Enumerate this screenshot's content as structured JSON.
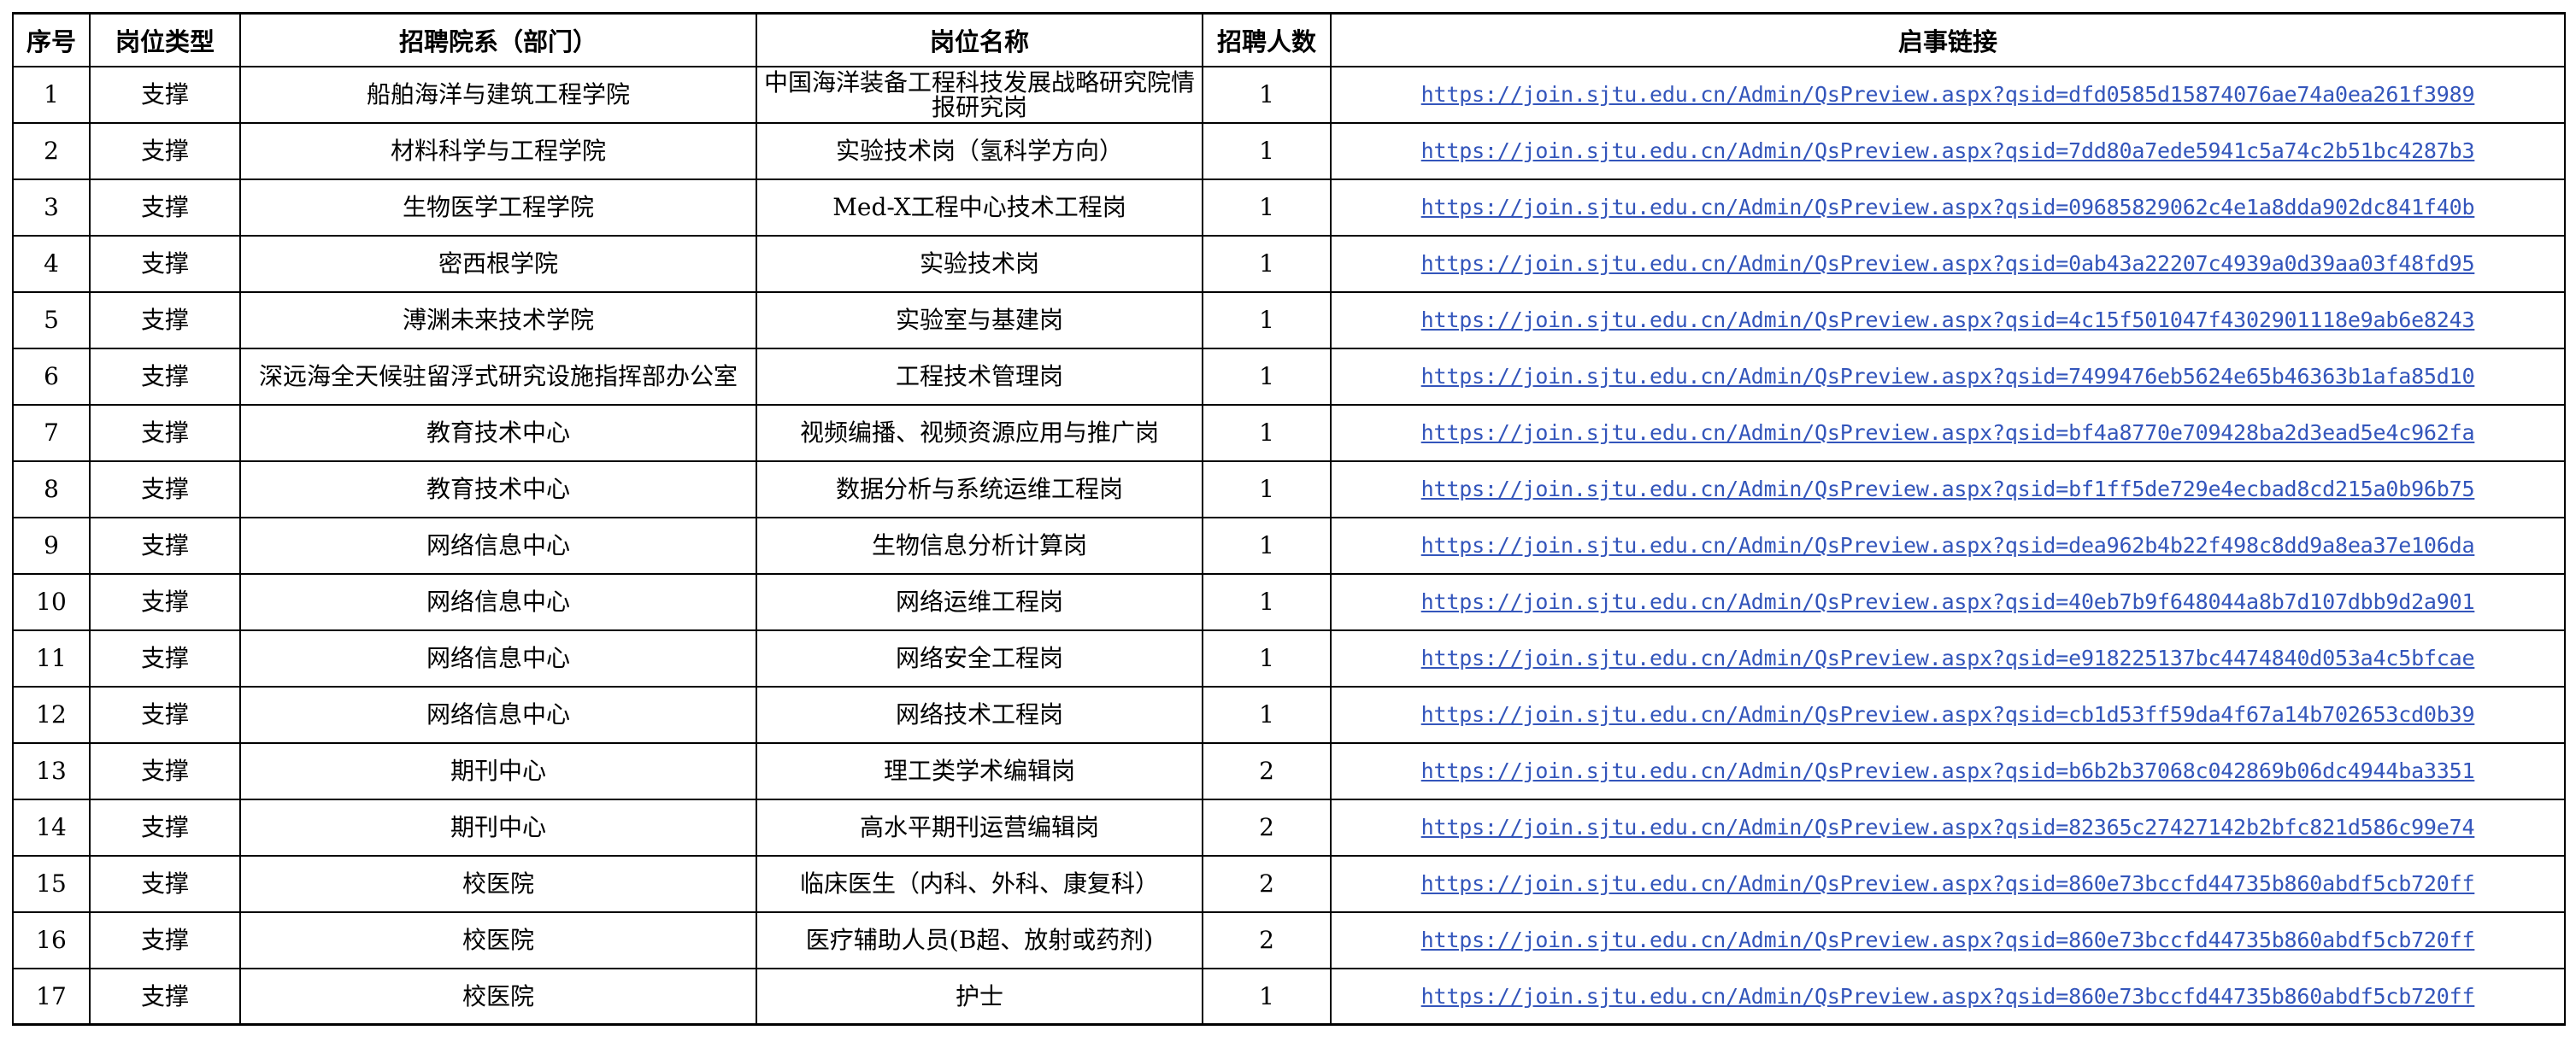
{
  "columns": [
    "序号",
    "岗位类型",
    "招聘院系（部门）",
    "岗位名称",
    "招聘人数",
    "启事链接"
  ],
  "rows": [
    {
      "no": "1",
      "type": "支撑",
      "dept": "船舶海洋与建筑工程学院",
      "position": "中国海洋装备工程科技发展战略研究院情报研究岗",
      "count": "1",
      "link": "https://join.sjtu.edu.cn/Admin/QsPreview.aspx?qsid=dfd0585d15874076ae74a0ea261f3989"
    },
    {
      "no": "2",
      "type": "支撑",
      "dept": "材料科学与工程学院",
      "position": "实验技术岗（氢科学方向）",
      "count": "1",
      "link": "https://join.sjtu.edu.cn/Admin/QsPreview.aspx?qsid=7dd80a7ede5941c5a74c2b51bc4287b3"
    },
    {
      "no": "3",
      "type": "支撑",
      "dept": "生物医学工程学院",
      "position": "Med-X工程中心技术工程岗",
      "count": "1",
      "link": "https://join.sjtu.edu.cn/Admin/QsPreview.aspx?qsid=09685829062c4e1a8dda902dc841f40b"
    },
    {
      "no": "4",
      "type": "支撑",
      "dept": "密西根学院",
      "position": "实验技术岗",
      "count": "1",
      "link": "https://join.sjtu.edu.cn/Admin/QsPreview.aspx?qsid=0ab43a22207c4939a0d39aa03f48fd95"
    },
    {
      "no": "5",
      "type": "支撑",
      "dept": "溥渊未来技术学院",
      "position": "实验室与基建岗",
      "count": "1",
      "link": "https://join.sjtu.edu.cn/Admin/QsPreview.aspx?qsid=4c15f501047f4302901118e9ab6e8243"
    },
    {
      "no": "6",
      "type": "支撑",
      "dept": "深远海全天候驻留浮式研究设施指挥部办公室",
      "position": "工程技术管理岗",
      "count": "1",
      "link": "https://join.sjtu.edu.cn/Admin/QsPreview.aspx?qsid=7499476eb5624e65b46363b1afa85d10"
    },
    {
      "no": "7",
      "type": "支撑",
      "dept": "教育技术中心",
      "position": "视频编播、视频资源应用与推广岗",
      "count": "1",
      "link": "https://join.sjtu.edu.cn/Admin/QsPreview.aspx?qsid=bf4a8770e709428ba2d3ead5e4c962fa"
    },
    {
      "no": "8",
      "type": "支撑",
      "dept": "教育技术中心",
      "position": "数据分析与系统运维工程岗",
      "count": "1",
      "link": "https://join.sjtu.edu.cn/Admin/QsPreview.aspx?qsid=bf1ff5de729e4ecbad8cd215a0b96b75"
    },
    {
      "no": "9",
      "type": "支撑",
      "dept": "网络信息中心",
      "position": "生物信息分析计算岗",
      "count": "1",
      "link": "https://join.sjtu.edu.cn/Admin/QsPreview.aspx?qsid=dea962b4b22f498c8dd9a8ea37e106da"
    },
    {
      "no": "10",
      "type": "支撑",
      "dept": "网络信息中心",
      "position": "网络运维工程岗",
      "count": "1",
      "link": "https://join.sjtu.edu.cn/Admin/QsPreview.aspx?qsid=40eb7b9f648044a8b7d107dbb9d2a901"
    },
    {
      "no": "11",
      "type": "支撑",
      "dept": "网络信息中心",
      "position": "网络安全工程岗",
      "count": "1",
      "link": "https://join.sjtu.edu.cn/Admin/QsPreview.aspx?qsid=e918225137bc4474840d053a4c5bfcae"
    },
    {
      "no": "12",
      "type": "支撑",
      "dept": "网络信息中心",
      "position": "网络技术工程岗",
      "count": "1",
      "link": "https://join.sjtu.edu.cn/Admin/QsPreview.aspx?qsid=cb1d53ff59da4f67a14b702653cd0b39"
    },
    {
      "no": "13",
      "type": "支撑",
      "dept": "期刊中心",
      "position": "理工类学术编辑岗",
      "count": "2",
      "link": "https://join.sjtu.edu.cn/Admin/QsPreview.aspx?qsid=b6b2b37068c042869b06dc4944ba3351"
    },
    {
      "no": "14",
      "type": "支撑",
      "dept": "期刊中心",
      "position": "高水平期刊运营编辑岗",
      "count": "2",
      "link": "https://join.sjtu.edu.cn/Admin/QsPreview.aspx?qsid=82365c27427142b2bfc821d586c99e74"
    },
    {
      "no": "15",
      "type": "支撑",
      "dept": "校医院",
      "position": "临床医生（内科、外科、康复科）",
      "count": "2",
      "link": "https://join.sjtu.edu.cn/Admin/QsPreview.aspx?qsid=860e73bccfd44735b860abdf5cb720ff"
    },
    {
      "no": "16",
      "type": "支撑",
      "dept": "校医院",
      "position": "医疗辅助人员(B超、放射或药剂)",
      "count": "2",
      "link": "https://join.sjtu.edu.cn/Admin/QsPreview.aspx?qsid=860e73bccfd44735b860abdf5cb720ff"
    },
    {
      "no": "17",
      "type": "支撑",
      "dept": "校医院",
      "position": "护士",
      "count": "1",
      "link": "https://join.sjtu.edu.cn/Admin/QsPreview.aspx?qsid=860e73bccfd44735b860abdf5cb720ff"
    }
  ]
}
